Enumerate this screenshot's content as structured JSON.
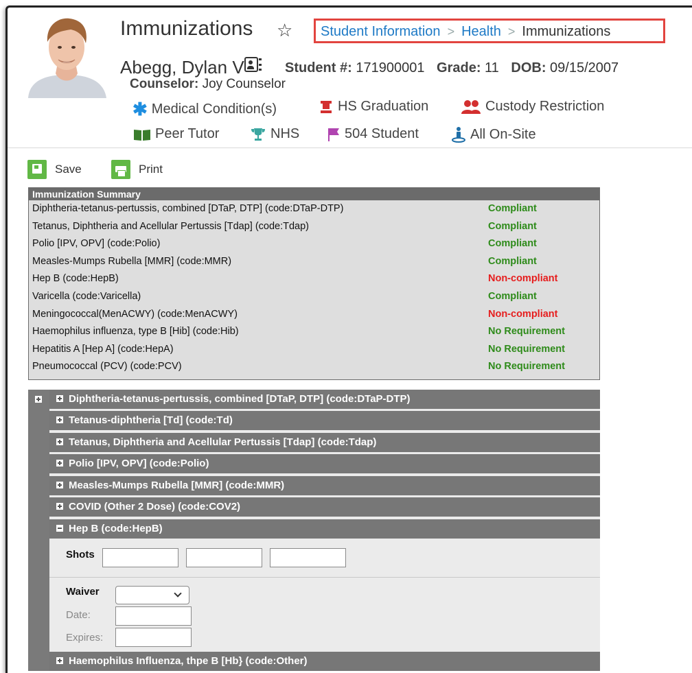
{
  "header": {
    "title": "Immunizations",
    "star_icon": "star-icon",
    "breadcrumb": [
      "Student Information",
      "Health",
      "Immunizations"
    ]
  },
  "student": {
    "name": "Abegg, Dylan V",
    "student_number_label": "Student #:",
    "student_number": "171900001",
    "grade_label": "Grade:",
    "grade": "11",
    "dob_label": "DOB:",
    "dob": "09/15/2007",
    "counselor_label": "Counselor:",
    "counselor": "Joy Counselor"
  },
  "flags": {
    "medical": {
      "label": "Medical Condition(s)",
      "icon": "asterisk-icon",
      "color": "#1e8ee0"
    },
    "hs_graduation": {
      "label": "HS Graduation",
      "icon": "graduation-cap-icon",
      "color": "#d32f2f"
    },
    "custody": {
      "label": "Custody Restriction",
      "icon": "people-icon",
      "color": "#d32f2f"
    },
    "peer_tutor": {
      "label": "Peer Tutor",
      "icon": "book-icon",
      "color": "#3a7d2c"
    },
    "nhs": {
      "label": "NHS",
      "icon": "trophy-icon",
      "color": "#3aa6a0"
    },
    "student_504": {
      "label": "504 Student",
      "icon": "flag-icon",
      "color": "#b044b0"
    },
    "all_onsite": {
      "label": "All On-Site",
      "icon": "person-pin-icon",
      "color": "#1f6fa8"
    }
  },
  "toolbar": {
    "save_label": "Save",
    "print_label": "Print",
    "accent": "#61b845"
  },
  "summary": {
    "title": "Immunization Summary",
    "rows": [
      {
        "name": "Diphtheria-tetanus-pertussis, combined [DTaP, DTP] (code:DTaP-DTP)",
        "status": "Compliant"
      },
      {
        "name": "Tetanus, Diphtheria and Acellular Pertussis [Tdap] (code:Tdap)",
        "status": "Compliant"
      },
      {
        "name": "Polio [IPV, OPV] (code:Polio)",
        "status": "Compliant"
      },
      {
        "name": "Measles-Mumps Rubella [MMR] (code:MMR)",
        "status": "Compliant"
      },
      {
        "name": "Hep B (code:HepB)",
        "status": "Non-compliant"
      },
      {
        "name": "Varicella (code:Varicella)",
        "status": "Compliant"
      },
      {
        "name": "Meningococcal(MenACWY) (code:MenACWY)",
        "status": "Non-compliant"
      },
      {
        "name": "Haemophilus influenza, type B [Hib] (code:Hib)",
        "status": "No Requirement"
      },
      {
        "name": "Hepatitis A [Hep A] (code:HepA)",
        "status": "No Requirement"
      },
      {
        "name": "Pneumococcal (PCV) (code:PCV)",
        "status": "No Requirement"
      }
    ],
    "status_colors": {
      "Compliant": "#2e8b1a",
      "Non-compliant": "#e61e1e",
      "No Requirement": "#2e8b1a"
    }
  },
  "accordion": {
    "items": [
      "Diphtheria-tetanus-pertussis, combined [DTaP, DTP] (code:DTaP-DTP)",
      "Tetanus-diphtheria [Td] (code:Td)",
      "Tetanus, Diphtheria and Acellular Pertussis [Tdap] (code:Tdap)",
      "Polio [IPV, OPV] (code:Polio)",
      "Measles-Mumps Rubella [MMR] (code:MMR)",
      "COVID (Other 2 Dose) (code:COV2)",
      "Hep B (code:HepB)",
      "Haemophilus Influenza, thpe B [Hb} (code:Other)"
    ],
    "expanded": {
      "shots_label": "Shots",
      "waiver_label": "Waiver",
      "date_label": "Date:",
      "expires_label": "Expires:"
    }
  }
}
